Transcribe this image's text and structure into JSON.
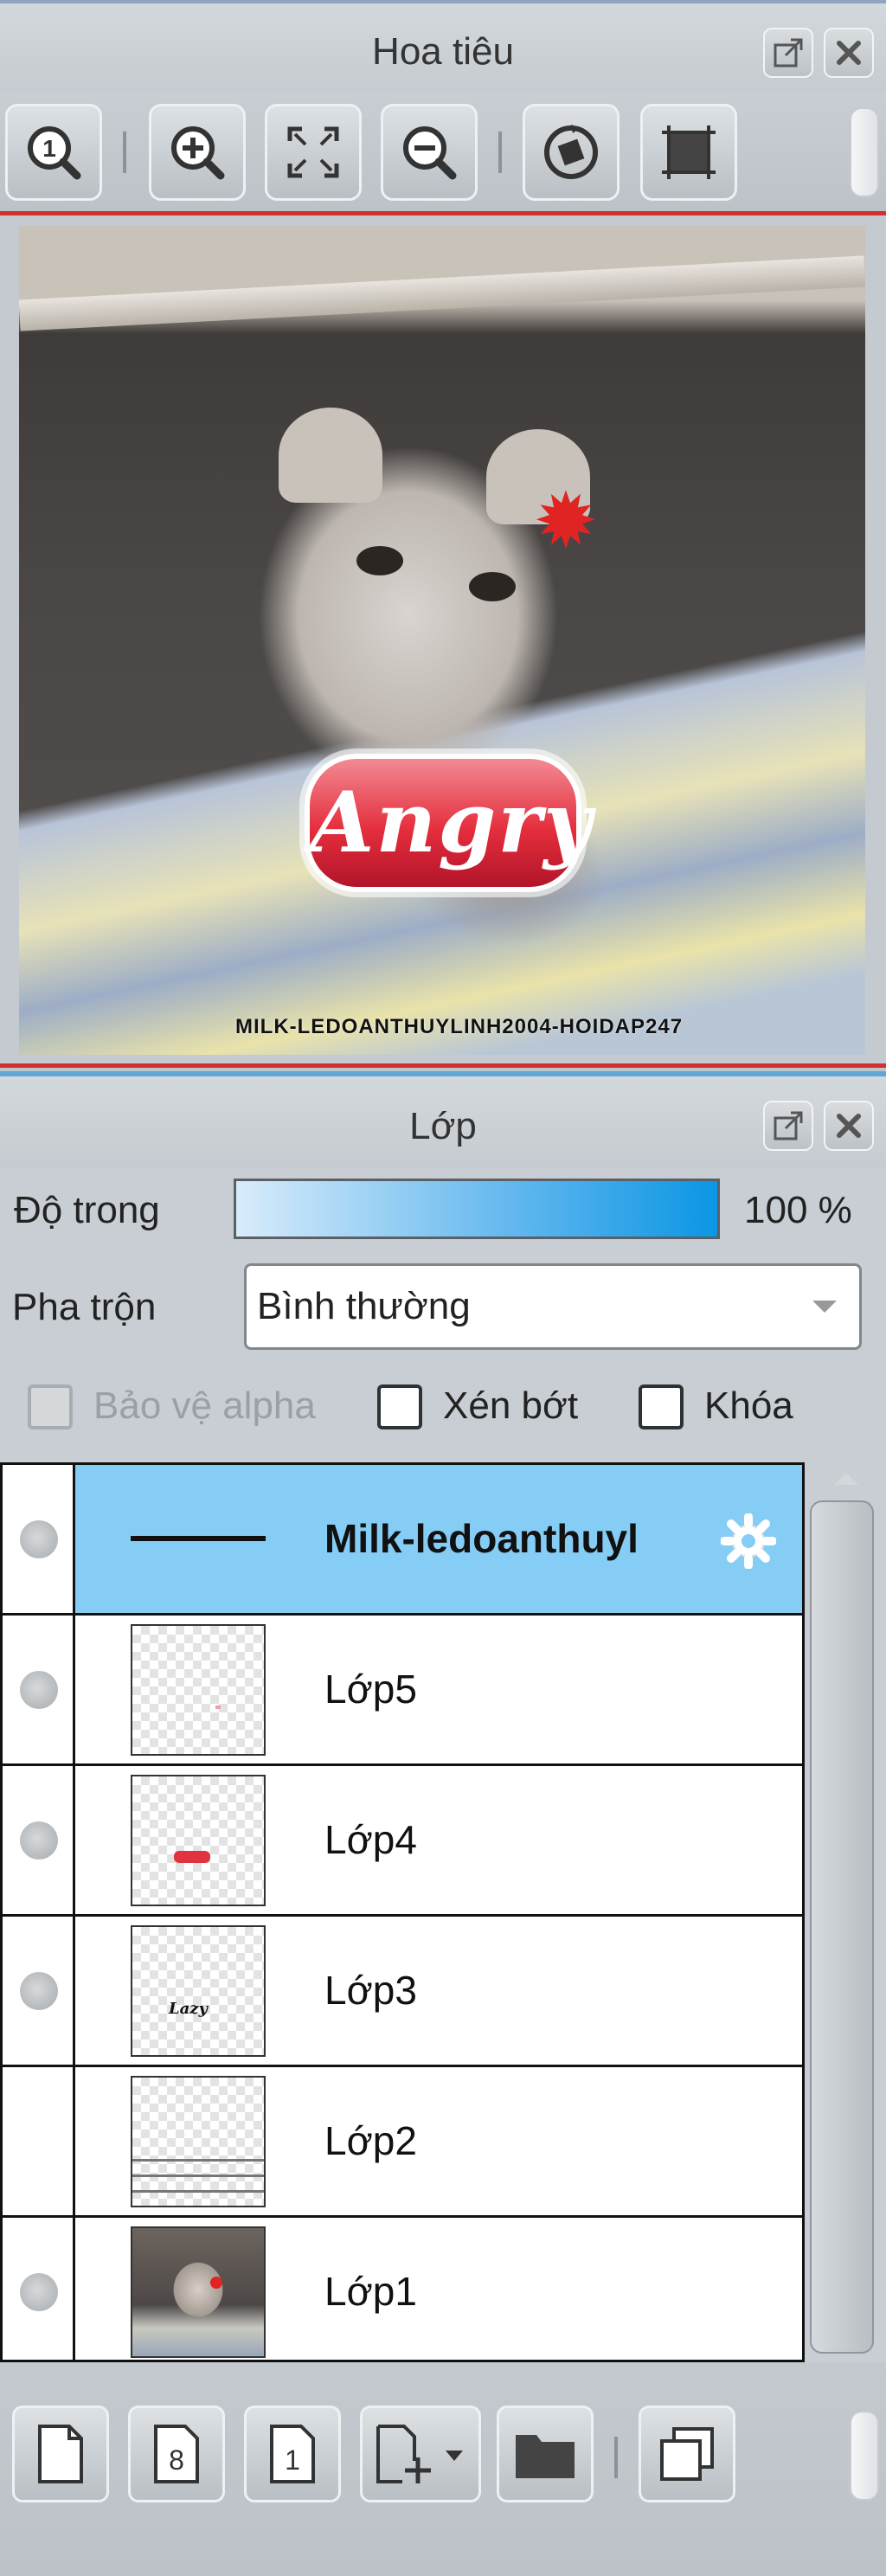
{
  "navigator": {
    "title": "Hoa tiêu",
    "image_watermark": "MILK-LEDOANTHUYLINH2004-HOIDAP247",
    "image_sticker_text": "Angry"
  },
  "layers_panel": {
    "title": "Lớp",
    "opacity_label": "Độ trong",
    "opacity_value": "100 %",
    "opacity_fraction": 1.0,
    "blend_label": "Pha trộn",
    "blend_value": "Bình thường",
    "checkboxes": {
      "protect_alpha": "Bảo vệ alpha",
      "clipping": "Xén bớt",
      "lock": "Khóa"
    },
    "layers": [
      {
        "name": "Milk-ledoanthuyl",
        "selected": true,
        "visible_dot": true
      },
      {
        "name": "Lớp5",
        "selected": false,
        "visible_dot": true
      },
      {
        "name": "Lớp4",
        "selected": false,
        "visible_dot": true
      },
      {
        "name": "Lớp3",
        "selected": false,
        "visible_dot": true
      },
      {
        "name": "Lớp2",
        "selected": false,
        "visible_dot": false
      },
      {
        "name": "Lớp1",
        "selected": false,
        "visible_dot": true
      }
    ],
    "toolbar_icons": [
      "new-layer-icon",
      "new-8bit-layer-icon",
      "new-1bit-layer-icon",
      "add-layer-menu-icon",
      "folder-icon",
      "duplicate-layer-icon"
    ],
    "thumbnail_labels": {
      "layer3": "Lazy"
    }
  },
  "colors": {
    "selected_row": "#86cdf6",
    "accent_red": "#d22f2f",
    "opacity_fill": "#0b96e4"
  }
}
